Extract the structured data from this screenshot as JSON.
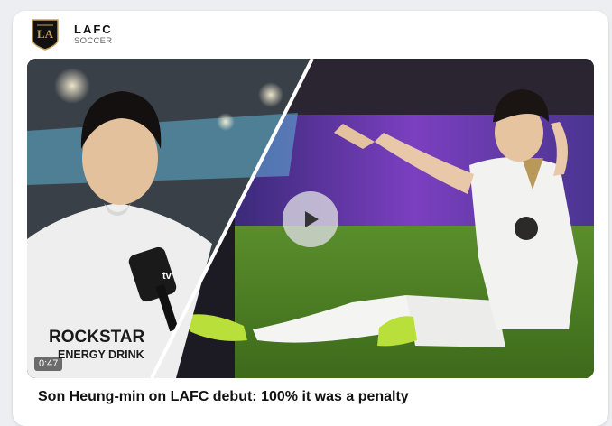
{
  "post": {
    "team_name": "LAFC",
    "team_category": "SOCCER",
    "logo_icon": "lafc-crest-icon",
    "video": {
      "duration": "0:47",
      "play_icon": "play-icon",
      "sponsor_line1": "ROCKSTAR",
      "sponsor_line2": "ENERGY DRINK",
      "mic_brand": "tv"
    },
    "headline": "Son Heung-min on LAFC debut: 100% it was a penalty"
  },
  "colors": {
    "card_bg": "#ffffff",
    "page_bg": "#eceef1",
    "crest_black": "#111111",
    "crest_gold": "#c6a15b",
    "kit_gold": "#b9985a"
  }
}
